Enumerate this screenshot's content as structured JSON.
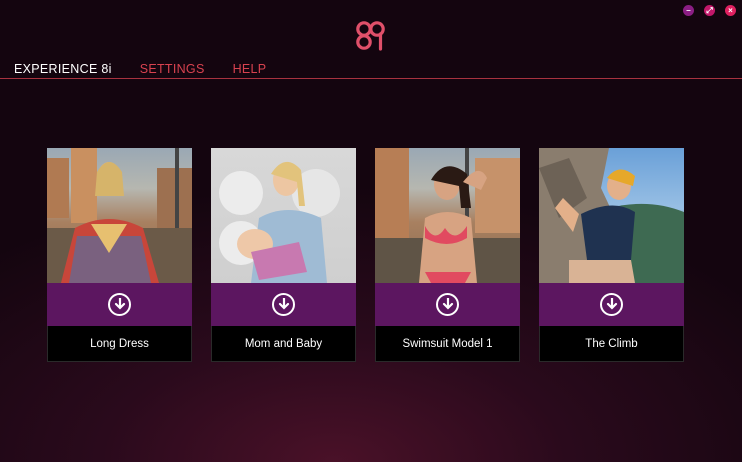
{
  "window": {
    "controls": [
      {
        "name": "minimize",
        "glyph": "–"
      },
      {
        "name": "maximize",
        "glyph": "⤢"
      },
      {
        "name": "close",
        "glyph": "×"
      }
    ]
  },
  "nav": {
    "items": [
      {
        "label": "EXPERIENCE 8i",
        "active": true
      },
      {
        "label": "SETTINGS",
        "active": false
      },
      {
        "label": "HELP",
        "active": false
      }
    ]
  },
  "colors": {
    "accent": "#5c1660",
    "nav_inactive": "#d8424f",
    "logo": "#e0506a"
  },
  "cards": [
    {
      "title": "Long Dress",
      "action_icon": "download-icon"
    },
    {
      "title": "Mom and Baby",
      "action_icon": "download-icon"
    },
    {
      "title": "Swimsuit Model 1",
      "action_icon": "download-icon"
    },
    {
      "title": "The Climb",
      "action_icon": "download-icon"
    }
  ]
}
